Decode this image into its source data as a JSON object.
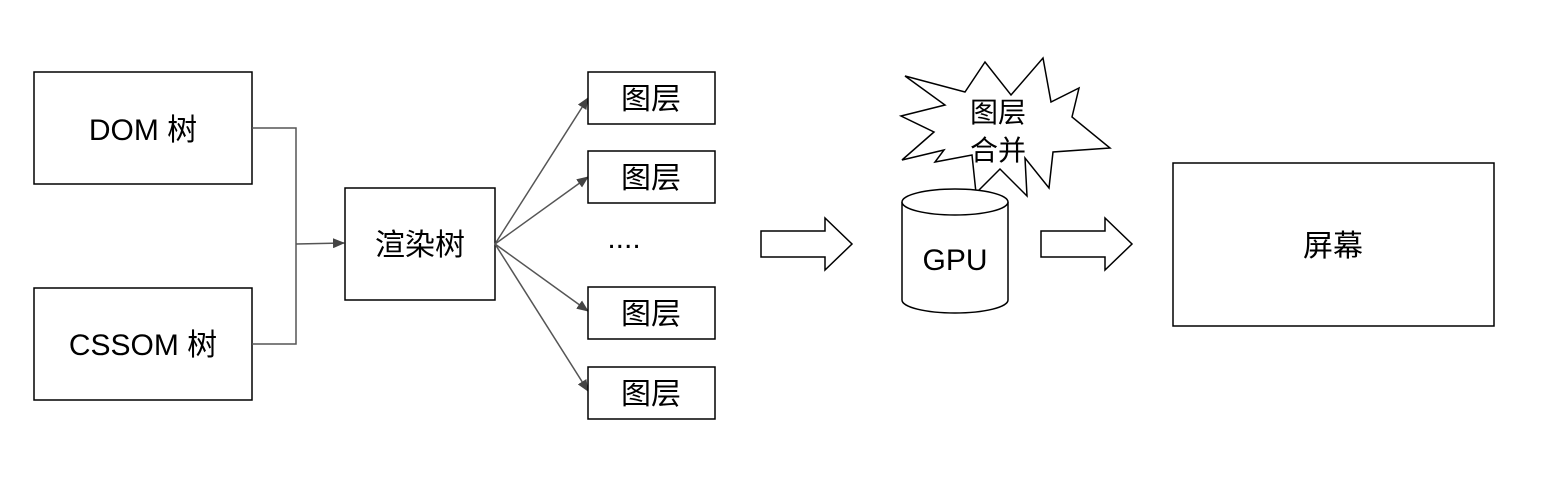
{
  "nodes": {
    "dom": "DOM 树",
    "cssom": "CSSOM 树",
    "render_tree": "渲染树",
    "layers": [
      "图层",
      "图层",
      "图层",
      "图层"
    ],
    "ellipsis": "....",
    "merge_line1": "图层",
    "merge_line2": "合并",
    "gpu": "GPU",
    "screen": "屏幕"
  }
}
